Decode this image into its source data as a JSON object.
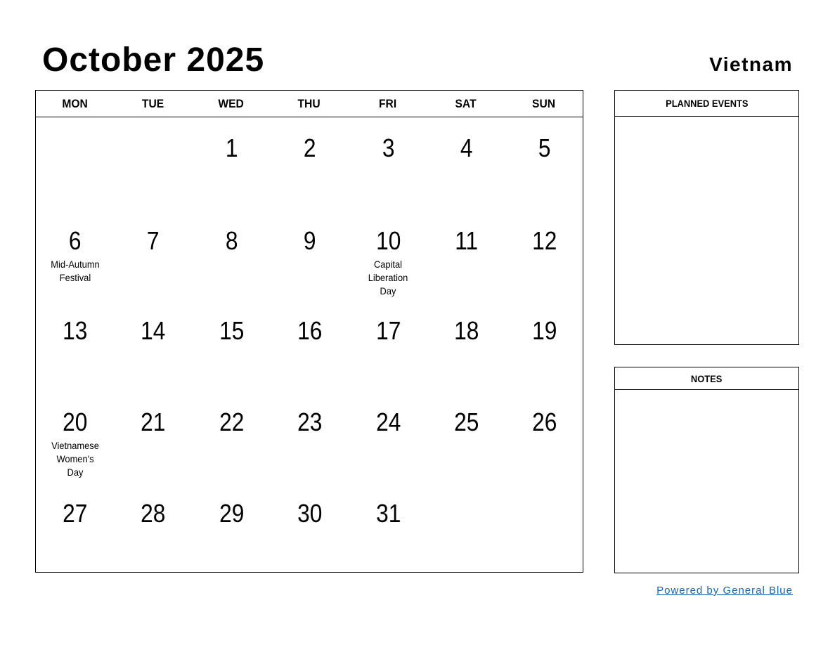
{
  "header": {
    "title": "October 2025",
    "country": "Vietnam"
  },
  "calendar": {
    "weekdays": [
      "MON",
      "TUE",
      "WED",
      "THU",
      "FRI",
      "SAT",
      "SUN"
    ],
    "weeks": [
      [
        {
          "day": ""
        },
        {
          "day": ""
        },
        {
          "day": "1"
        },
        {
          "day": "2"
        },
        {
          "day": "3"
        },
        {
          "day": "4"
        },
        {
          "day": "5"
        }
      ],
      [
        {
          "day": "6",
          "holiday": "Mid-Autumn Festival"
        },
        {
          "day": "7"
        },
        {
          "day": "8"
        },
        {
          "day": "9"
        },
        {
          "day": "10",
          "holiday": "Capital Liberation Day"
        },
        {
          "day": "11"
        },
        {
          "day": "12"
        }
      ],
      [
        {
          "day": "13"
        },
        {
          "day": "14"
        },
        {
          "day": "15"
        },
        {
          "day": "16"
        },
        {
          "day": "17"
        },
        {
          "day": "18"
        },
        {
          "day": "19"
        }
      ],
      [
        {
          "day": "20",
          "holiday": "Vietnamese Women's Day"
        },
        {
          "day": "21"
        },
        {
          "day": "22"
        },
        {
          "day": "23"
        },
        {
          "day": "24"
        },
        {
          "day": "25"
        },
        {
          "day": "26"
        }
      ],
      [
        {
          "day": "27"
        },
        {
          "day": "28"
        },
        {
          "day": "29"
        },
        {
          "day": "30"
        },
        {
          "day": "31"
        },
        {
          "day": ""
        },
        {
          "day": ""
        }
      ]
    ]
  },
  "panels": {
    "planned_events": {
      "title": "PLANNED EVENTS"
    },
    "notes": {
      "title": "NOTES"
    }
  },
  "footer": {
    "link_text": "Powered by General Blue"
  }
}
